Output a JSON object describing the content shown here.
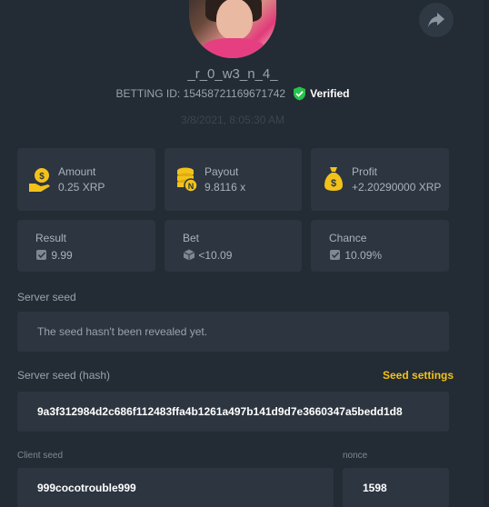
{
  "profile": {
    "username": "_r_0_w3_n_4_",
    "betting_id": "BETTING ID: 15458721169671742",
    "verified_label": "Verified",
    "date": "3/8/2021, 8:05:30 AM"
  },
  "stats": {
    "amount": {
      "label": "Amount",
      "value": "0.25 XRP",
      "icon": "coin-hand-icon"
    },
    "payout": {
      "label": "Payout",
      "value": "9.8116 x",
      "icon": "coin-stack-icon"
    },
    "profit": {
      "label": "Profit",
      "value": "+2.20290000 XRP",
      "icon": "money-bag-icon"
    },
    "result": {
      "label": "Result",
      "value": "9.99",
      "icon": "dice-check-icon"
    },
    "bet": {
      "label": "Bet",
      "value": "<10.09",
      "icon": "cube-icon"
    },
    "chance": {
      "label": "Chance",
      "value": "10.09%",
      "icon": "dice-check-icon"
    }
  },
  "server_seed": {
    "label": "Server seed",
    "value": "The seed hasn't been revealed yet."
  },
  "server_seed_hash": {
    "label": "Server seed (hash)",
    "settings_label": "Seed settings",
    "value": "9a3f312984d2c686f112483ffa4b1261a497b141d9d7e3660347a5bedd1d8"
  },
  "client_seed": {
    "label": "Client seed",
    "value": "999cocotrouble999"
  },
  "nonce": {
    "label": "nonce",
    "value": "1598"
  },
  "colors": {
    "background": "#232b34",
    "card": "#2c3540",
    "accent_yellow": "#f2c21b",
    "verified_green": "#26c44a"
  }
}
